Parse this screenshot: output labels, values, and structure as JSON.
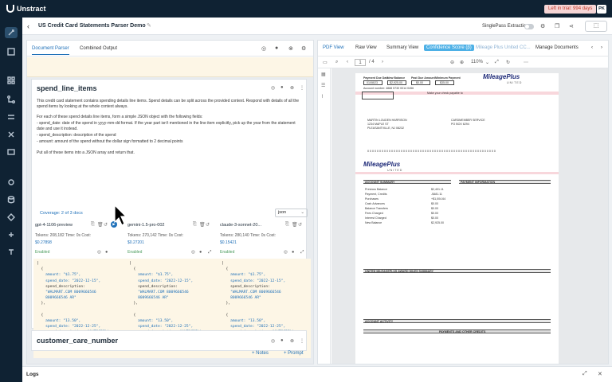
{
  "app": {
    "brand": "Unstract",
    "trial_badge": "Left in trial: 994 days",
    "user_initials": "PK"
  },
  "header": {
    "back": "‹",
    "title": "US Credit Card Statements Parser Demo",
    "singlepass_label": "SinglePass Extraction"
  },
  "left_tabs": [
    "Document Parser",
    "Combined Output"
  ],
  "prompt": {
    "title": "spend_line_items",
    "desc1": "This credit card statement contains spending details line items. Spend details can be split across the provided context. Respond with details of all the spend items by looking at the whole context always.",
    "desc2": "For each of these spend details line items, form a simple JSON object with the following fields:",
    "desc3": "- spend_date: date of the spend in yyyy-mm-dd format. If the year part isn't mentioned in the line item explicitly, pick up the year from the statement date and use it instead.",
    "desc4": "- spend_description: description of the spend",
    "desc5": "- amount: amount of the spend without the dollar sign formatted to 2 decimal points",
    "desc6": "Put all of these items into a JSON array and return that.",
    "coverage": "Coverage: 2 of 3 docs",
    "format": "json"
  },
  "models": [
    {
      "name": "gpt-4-1106-preview",
      "stats": "Tokens: 208,182  Time: 0s  Cost:",
      "cost": "$0.27898",
      "enabled": "Enabled",
      "code": [
        "[",
        "  {",
        "    amount: \"$1.75\",",
        "    spend_date: \"2022-12-15\",",
        "    spend_description:",
        "    \"WALMART.COM 8009666546",
        "    8009666546 AR\"",
        "  },",
        "",
        "  {",
        "    amount: \"13.50\",",
        "    spend_date: \"2022-12-25\",",
        "    spend_description: \"AUTOGRILL",
        "    ST LAZ PARIS\"",
        "  }"
      ]
    },
    {
      "name": "gemini-1.5-pro-002",
      "stats": "Tokens: 270,142  Time: 0s  Cost:",
      "cost": "$0.27201",
      "enabled": "Enabled",
      "code": [
        "[",
        "  {",
        "    amount: \"$1.75\",",
        "    spend_date: \"2022-12-15\",",
        "    spend_description:",
        "    \"WALMART.COM 8009666546",
        "    8009666546 AR\"",
        "  },",
        "",
        "  {",
        "    amount: \"13.50\",",
        "    spend_date: \"2022-12-25\",",
        "    spend_description: \"AUTOGRILL",
        "    ST LAZ PARIS\"",
        "  }"
      ]
    },
    {
      "name": "claude-3-sonnet-20...",
      "stats": "Tokens: 280,140  Time: 0s  Cost:",
      "cost": "$0.15421",
      "enabled": "Enabled",
      "code": [
        "[",
        "  {",
        "    amount: \"$1.75\",",
        "    spend_date: \"2022-12-15\",",
        "    spend_description:",
        "    \"WALMART.COM 8009666546",
        "    8009666546 AR\"",
        "  },",
        "",
        "  {",
        "    amount: \"13.50\",",
        "    spend_date: \"2022-12-25\",",
        "    spend_description: \"AUTOGRILL",
        "    ST LAZ PARIS\"",
        "  }"
      ]
    }
  ],
  "next_prompt": {
    "title": "customer_care_number"
  },
  "footer": {
    "notes": "+ Notes",
    "prompt": "+ Prompt"
  },
  "right_tabs": [
    "PDF View",
    "Raw View",
    "Summary View",
    "Confidence Score (β)",
    "Mileage Plus United CC...",
    "Manage Documents"
  ],
  "pdf_toolbar": {
    "page": "1",
    "total": "/ 4",
    "zoom": "110%"
  },
  "pdf": {
    "brand": "MileagePlus",
    "united": "UNITED",
    "headers": [
      "Payment Due Date",
      "New Balance",
      "Past Due Amount",
      "Minimum Payment"
    ],
    "values": [
      "01/08/23",
      "$2,925.00",
      "$0.00",
      "$35.00"
    ],
    "account": "Account number: 4888 5730 0014 0456",
    "address1": "MARTIN LOUDEN HARRISON",
    "address2": "1234 MAPLE ST",
    "address3": "PLEASANTVILLE, NJ 08232",
    "summary_title": "ACCOUNT SUMMARY",
    "payment_title": "PAYMENT INFORMATION",
    "miles_title": "UNITED MILEAGEPLUS AWARD MILES SUMMARY",
    "activity_title": "ACCOUNT ACTIVITY",
    "activity_sub": "PAYMENTS AND OTHER CREDITS",
    "summary_rows": [
      "Previous Balance",
      "Payment, Credits",
      "Purchases",
      "Cash Advances",
      "Balance Transfers",
      "Fees Charged",
      "Interest Charged",
      "New Balance"
    ],
    "summary_vals": [
      "$2,401.11",
      "-$481.11",
      "+$1,004.64",
      "$0.00",
      "$0.00",
      "$0.00",
      "$0.00",
      "$2,925.00"
    ]
  },
  "logs": {
    "label": "Logs"
  }
}
